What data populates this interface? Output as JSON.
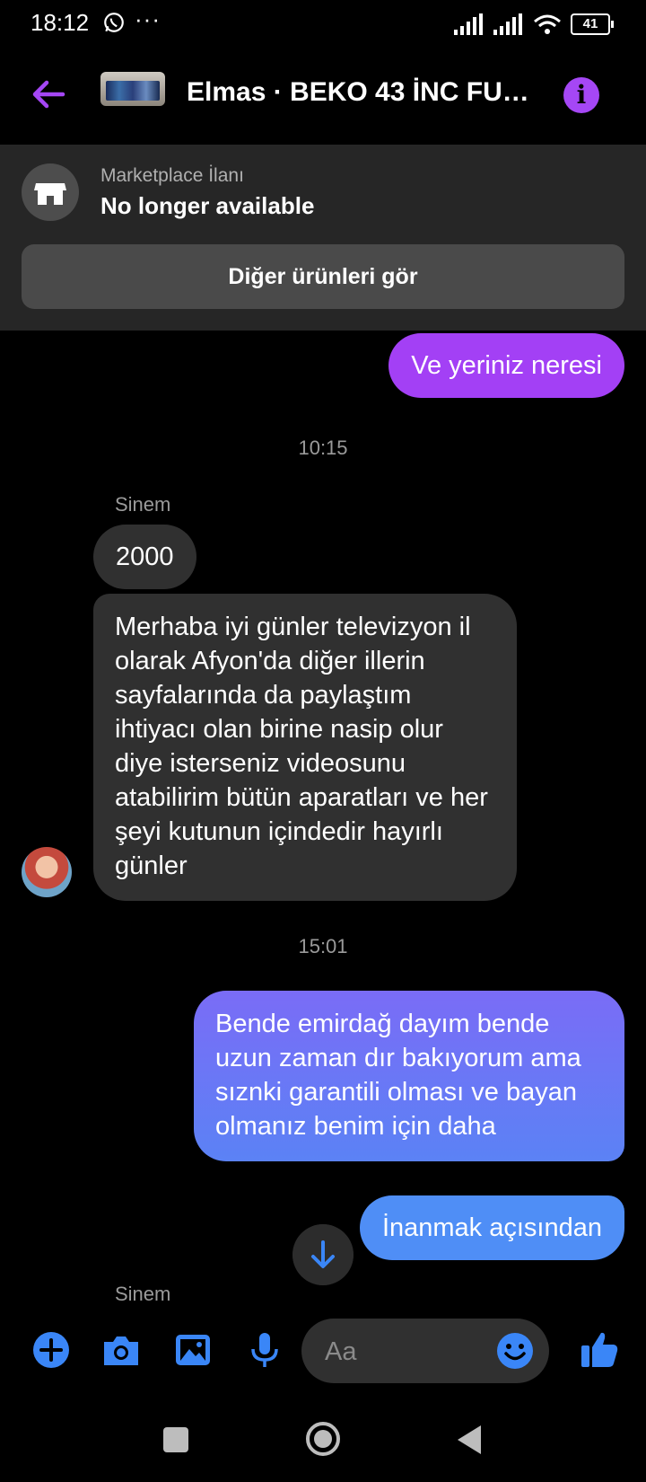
{
  "status_bar": {
    "time": "18:12",
    "dots": "···",
    "battery": "41"
  },
  "header": {
    "title": "Elmas · BEKO 43 İNC FULL HD SMART TV",
    "accent_color": "#a547f5",
    "info_icon": "i"
  },
  "banner": {
    "label": "Marketplace İlanı",
    "status": "No longer available",
    "button_label": "Diğer ürünleri gör"
  },
  "messages": {
    "out1": "Ve yeriniz neresi",
    "time1": "10:15",
    "sender1": "Sinem",
    "in1": "2000",
    "in2": "Merhaba iyi günler televizyon il olarak Afyon'da diğer illerin sayfalarında da paylaştım ihtiyacı olan birine nasip olur diye isterseniz videosunu atabilirim bütün aparatları ve her şeyi kutunun içindedir hayırlı günler",
    "time2": "15:01",
    "out2": "Bende emirdağ dayım bende uzun zaman dır bakıyorum ama  sıznki garantili olması ve bayan olmanız benim için daha",
    "out3": "İnanmak açısından",
    "sender2": "Sinem"
  },
  "composer": {
    "placeholder": "Aa",
    "icon_color": "#3a86f7"
  },
  "icons": [
    "whatsapp-icon",
    "signal-icon",
    "wifi-icon",
    "battery-icon",
    "back-arrow-icon",
    "info-icon",
    "shop-icon",
    "arrow-down-icon",
    "plus-icon",
    "camera-icon",
    "gallery-icon",
    "microphone-icon",
    "emoji-icon",
    "thumbs-up-icon"
  ]
}
